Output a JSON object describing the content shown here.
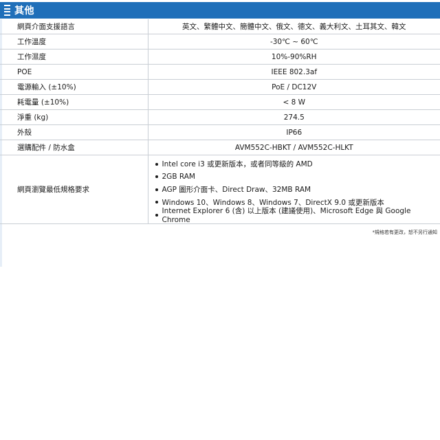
{
  "section": {
    "title": "其他"
  },
  "rows": [
    {
      "label": "網頁介面支援語言",
      "value": "英文、繁體中文、簡體中文、俄文、德文、義大利文、土耳其文、韓文"
    },
    {
      "label": "工作溫度",
      "value": "-30℃  ~ 60℃"
    },
    {
      "label": "工作濕度",
      "value": "10%-90%RH"
    },
    {
      "label": "POE",
      "value": "IEEE 802.3af"
    },
    {
      "label": "電源輸入 (±10%)",
      "value": "PoE / DC12V"
    },
    {
      "label": "耗電量 (±10%)",
      "value": "< 8 W"
    },
    {
      "label": "淨重 (kg)",
      "value": "274.5"
    },
    {
      "label": "外殼",
      "value": "IP66"
    },
    {
      "label": "選購配件 / 防水盒",
      "value": "AVM552C-HBKT / AVM552C-HLKT"
    }
  ],
  "browser_requirements": {
    "label": "網頁瀏覽最低規格要求",
    "items": [
      "Intel core i3 或更新版本，或者同等級的 AMD",
      "2GB RAM",
      "AGP 圖形介面卡、Direct Draw、32MB RAM",
      "Windows 10、Windows 8、Windows 7、DirectX 9.0 或更新版本",
      "Internet Explorer 6 (含) 以上版本 (建議使用)、Microsoft Edge 與 Google Chrome"
    ]
  },
  "footnote": "*規格若有更改，恕不另行通知"
}
